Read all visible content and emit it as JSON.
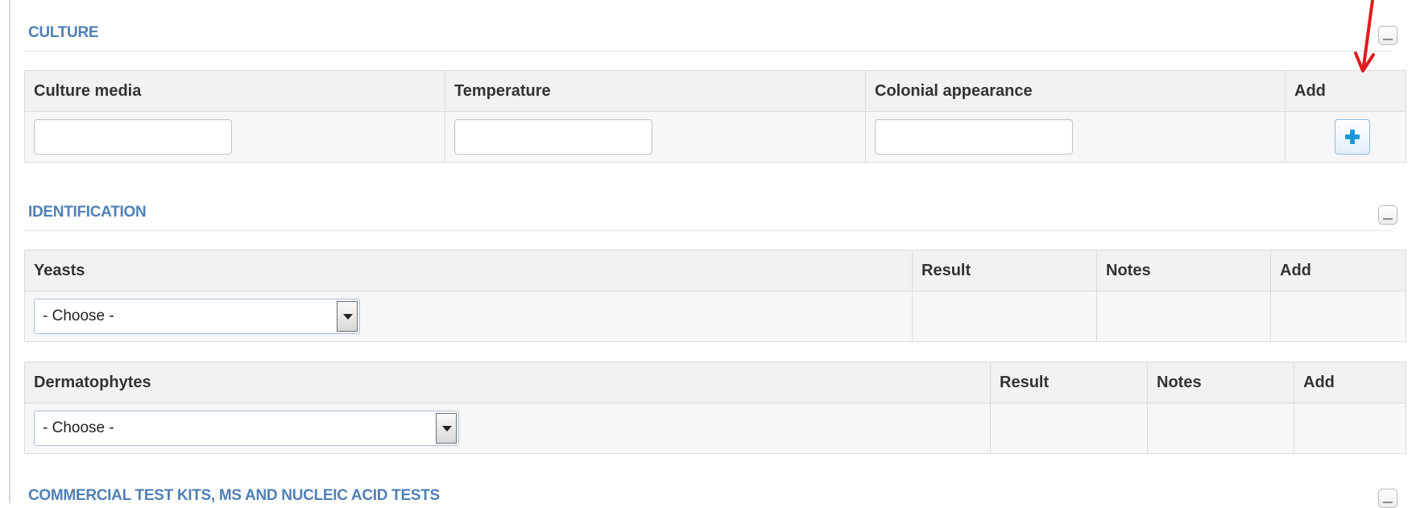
{
  "culture": {
    "title": "CULTURE",
    "columns": [
      "Culture media",
      "Temperature",
      "Colonial appearance",
      "Add"
    ]
  },
  "identification": {
    "title": "IDENTIFICATION",
    "yeasts": {
      "columns": [
        "Yeasts",
        "Result",
        "Notes",
        "Add"
      ],
      "select_value": "- Choose -"
    },
    "dermatophytes": {
      "columns": [
        "Dermatophytes",
        "Result",
        "Notes",
        "Add"
      ],
      "select_value": "- Choose -"
    }
  },
  "commercial": {
    "title": "COMMERCIAL TEST KITS, MS AND NUCLEIC ACID TESTS"
  },
  "icons": {
    "add": "plus-icon",
    "collapse": "minimize-icon",
    "annotation": "red-arrow"
  },
  "colors": {
    "section_title": "#4f80b4",
    "plus": "#1a9ad6",
    "annotation_arrow": "#e21b1b"
  }
}
